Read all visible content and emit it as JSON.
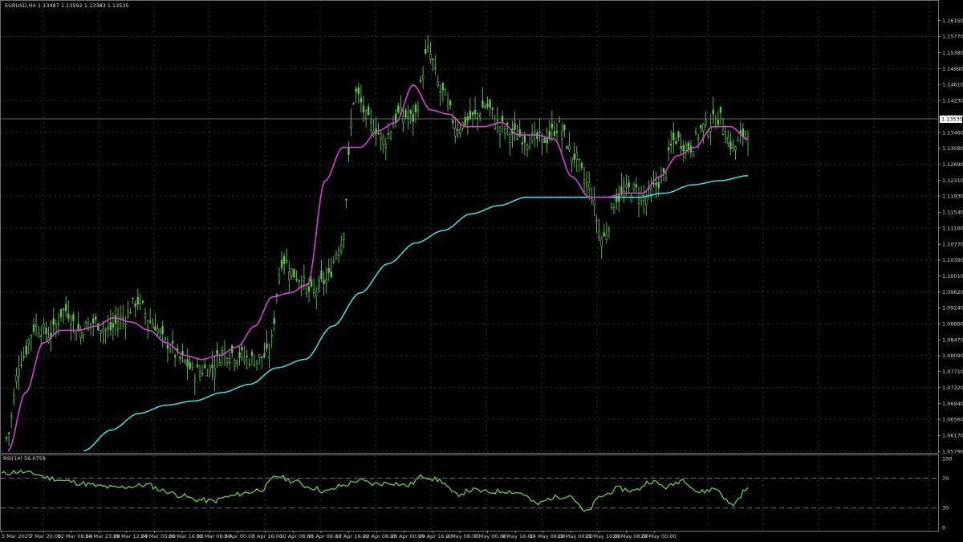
{
  "window": {
    "symbol_title": "EURUSD,H4",
    "ohlc": "1.13487 1.13592 1.13383 1.13535"
  },
  "chart_data": [
    {
      "type": "line",
      "subtype": "candlestick-like price series",
      "ylim": [
        1.0579,
        1.1655
      ],
      "y_ticks": [
        "1.16150",
        "1.15770",
        "1.15380",
        "1.14990",
        "1.14610",
        "1.14230",
        "1.13840",
        "1.13460",
        "1.13080",
        "1.12690",
        "1.12310",
        "1.11930",
        "1.11540",
        "1.11160",
        "1.10770",
        "1.10390",
        "1.10010",
        "1.09620",
        "1.09240",
        "1.08860",
        "1.08470",
        "1.08090",
        "1.07710",
        "1.07320",
        "1.06940",
        "1.06560",
        "1.06170",
        "1.05790"
      ],
      "current_price_label": "1.13535",
      "current_price": 1.13535,
      "grid": true,
      "colors": {
        "price": "#5ec24a",
        "ma_fast": "#d63fd6",
        "ma_slow": "#40d6d6",
        "background": "#000000",
        "grid": "#2a2a2a"
      },
      "price_anchors": [
        [
          0,
          1.061
        ],
        [
          1,
          1.08
        ],
        [
          2,
          1.088
        ],
        [
          3,
          1.086
        ],
        [
          4,
          1.092
        ],
        [
          5,
          1.087
        ],
        [
          6,
          1.089
        ],
        [
          7,
          1.087
        ],
        [
          8,
          1.09
        ],
        [
          9,
          1.094
        ],
        [
          10,
          1.089
        ],
        [
          11,
          1.084
        ],
        [
          12,
          1.08
        ],
        [
          13,
          1.077
        ],
        [
          14,
          1.078
        ],
        [
          15,
          1.082
        ],
        [
          16,
          1.081
        ],
        [
          17,
          1.08
        ],
        [
          18,
          1.081
        ],
        [
          19,
          1.104
        ],
        [
          20,
          1.1
        ],
        [
          21,
          1.096
        ],
        [
          22,
          1.099
        ],
        [
          23,
          1.108
        ],
        [
          24,
          1.144
        ],
        [
          25,
          1.137
        ],
        [
          26,
          1.133
        ],
        [
          27,
          1.139
        ],
        [
          28,
          1.138
        ],
        [
          29,
          1.154
        ],
        [
          30,
          1.144
        ],
        [
          31,
          1.136
        ],
        [
          32,
          1.138
        ],
        [
          33,
          1.141
        ],
        [
          34,
          1.136
        ],
        [
          35,
          1.134
        ],
        [
          36,
          1.133
        ],
        [
          37,
          1.133
        ],
        [
          38,
          1.136
        ],
        [
          39,
          1.129
        ],
        [
          40,
          1.122
        ],
        [
          41,
          1.109
        ],
        [
          42,
          1.119
        ],
        [
          43,
          1.121
        ],
        [
          44,
          1.119
        ],
        [
          45,
          1.123
        ],
        [
          46,
          1.133
        ],
        [
          47,
          1.131
        ],
        [
          48,
          1.136
        ],
        [
          49,
          1.138
        ],
        [
          50,
          1.131
        ],
        [
          51,
          1.1353
        ]
      ],
      "ma_fast_anchors": [
        [
          0,
          1.058
        ],
        [
          1,
          1.072
        ],
        [
          2,
          1.084
        ],
        [
          3,
          1.087
        ],
        [
          4,
          1.087
        ],
        [
          5,
          1.088
        ],
        [
          6,
          1.09
        ],
        [
          7,
          1.089
        ],
        [
          8,
          1.087
        ],
        [
          9,
          1.084
        ],
        [
          10,
          1.081
        ],
        [
          11,
          1.08
        ],
        [
          12,
          1.081
        ],
        [
          13,
          1.083
        ],
        [
          14,
          1.088
        ],
        [
          15,
          1.095
        ],
        [
          16,
          1.096
        ],
        [
          17,
          1.098
        ],
        [
          18,
          1.123
        ],
        [
          19,
          1.131
        ],
        [
          20,
          1.131
        ],
        [
          21,
          1.135
        ],
        [
          22,
          1.137
        ],
        [
          23,
          1.146
        ],
        [
          24,
          1.14
        ],
        [
          25,
          1.139
        ],
        [
          26,
          1.136
        ],
        [
          27,
          1.136
        ],
        [
          28,
          1.137
        ],
        [
          29,
          1.134
        ],
        [
          30,
          1.134
        ],
        [
          31,
          1.133
        ],
        [
          32,
          1.124
        ],
        [
          33,
          1.119
        ],
        [
          34,
          1.119
        ],
        [
          35,
          1.12
        ],
        [
          36,
          1.12
        ],
        [
          37,
          1.124
        ],
        [
          38,
          1.129
        ],
        [
          39,
          1.131
        ],
        [
          40,
          1.136
        ],
        [
          41,
          1.136
        ],
        [
          42,
          1.133
        ]
      ],
      "ma_slow_anchors": [
        [
          0,
          1.058
        ],
        [
          1,
          1.063
        ],
        [
          2,
          1.067
        ],
        [
          3,
          1.069
        ],
        [
          4,
          1.07
        ],
        [
          5,
          1.072
        ],
        [
          6,
          1.074
        ],
        [
          7,
          1.078
        ],
        [
          8,
          1.08
        ],
        [
          9,
          1.088
        ],
        [
          10,
          1.096
        ],
        [
          11,
          1.103
        ],
        [
          12,
          1.108
        ],
        [
          13,
          1.111
        ],
        [
          14,
          1.115
        ],
        [
          15,
          1.117
        ],
        [
          16,
          1.119
        ],
        [
          17,
          1.119
        ],
        [
          18,
          1.119
        ],
        [
          19,
          1.119
        ],
        [
          20,
          1.119
        ],
        [
          21,
          1.12
        ],
        [
          22,
          1.122
        ],
        [
          23,
          1.123
        ],
        [
          24,
          1.1242
        ]
      ]
    },
    {
      "type": "line",
      "title": "RSI(14) 56.0759",
      "ylim": [
        0,
        100
      ],
      "y_ticks": [
        "100",
        "70",
        "30",
        "0"
      ],
      "levels": [
        70,
        30
      ],
      "colors": {
        "rsi": "#5ec24a",
        "level": "#8a8a8a"
      },
      "rsi_anchors": [
        [
          0,
          76
        ],
        [
          1,
          79
        ],
        [
          2,
          76
        ],
        [
          3,
          70
        ],
        [
          4,
          66
        ],
        [
          5,
          63
        ],
        [
          6,
          59
        ],
        [
          7,
          57
        ],
        [
          8,
          59
        ],
        [
          9,
          61
        ],
        [
          10,
          53
        ],
        [
          11,
          47
        ],
        [
          12,
          41
        ],
        [
          13,
          39
        ],
        [
          14,
          45
        ],
        [
          15,
          50
        ],
        [
          16,
          55
        ],
        [
          17,
          73
        ],
        [
          18,
          66
        ],
        [
          19,
          58
        ],
        [
          20,
          52
        ],
        [
          21,
          60
        ],
        [
          22,
          67
        ],
        [
          23,
          62
        ],
        [
          24,
          64
        ],
        [
          25,
          60
        ],
        [
          26,
          73
        ],
        [
          27,
          67
        ],
        [
          28,
          48
        ],
        [
          29,
          54
        ],
        [
          30,
          51
        ],
        [
          31,
          53
        ],
        [
          32,
          50
        ],
        [
          33,
          35
        ],
        [
          34,
          44
        ],
        [
          35,
          47
        ],
        [
          36,
          24
        ],
        [
          37,
          46
        ],
        [
          38,
          56
        ],
        [
          39,
          53
        ],
        [
          40,
          66
        ],
        [
          41,
          58
        ],
        [
          42,
          68
        ],
        [
          43,
          51
        ],
        [
          44,
          56
        ],
        [
          45,
          34
        ],
        [
          46,
          56
        ]
      ]
    }
  ],
  "x_ticks": [
    "5 Mar 2025",
    "7 Mar 20:00",
    "12 Mar 08:00",
    "14 Mar 23:00",
    "19 Mar 12:00",
    "24 Mar 00:00",
    "26 Mar 16:00",
    "31 Mar 08:00",
    "3 Apr 00:00",
    "7 Apr 16:00",
    "10 Apr 08:00",
    "15 Apr 08:00",
    "17 Apr 16:00",
    "22 Apr 08:00",
    "25 Apr 00:00",
    "29 Apr 16:00",
    "2 May 08:00",
    "7 May 00:00",
    "9 May 16:00",
    "14 May 08:00",
    "19 May 00:00",
    "21 May 16:00",
    "26 May 08:00",
    "29 May 00:00"
  ]
}
